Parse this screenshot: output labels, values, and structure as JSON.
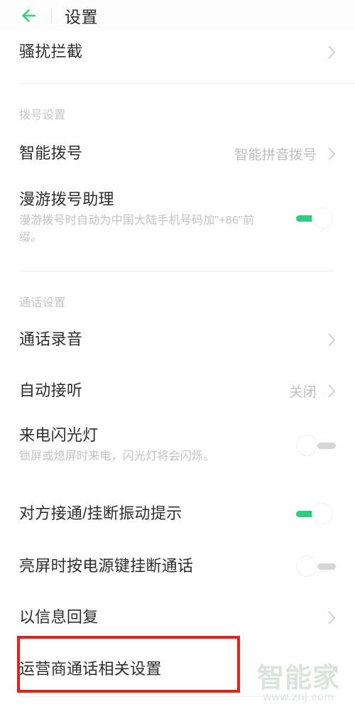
{
  "header": {
    "back_icon": "back-arrow-icon",
    "title": "设置",
    "accent_color": "#3ecf78"
  },
  "sections": [
    {
      "label": null,
      "rows": [
        {
          "name": "harassment-blocking",
          "title": "骚扰拦截",
          "desc": null,
          "value": null,
          "control": "chevron"
        }
      ]
    },
    {
      "label": "拨号设置",
      "rows": [
        {
          "name": "smart-dial",
          "title": "智能拨号",
          "desc": null,
          "value": "智能拼音拨号",
          "control": "chevron"
        },
        {
          "name": "roaming-dial-assistant",
          "title": "漫游拨号助理",
          "desc": "漫游拨号时自动为中国大陆手机号码加\"+86\"前缀。",
          "value": null,
          "control": "toggle",
          "toggle_state": "on"
        }
      ]
    },
    {
      "label": "通话设置",
      "rows": [
        {
          "name": "call-recording",
          "title": "通话录音",
          "desc": null,
          "value": null,
          "control": "chevron"
        },
        {
          "name": "auto-answer",
          "title": "自动接听",
          "desc": null,
          "value": "关闭",
          "control": "chevron"
        },
        {
          "name": "incoming-call-flash",
          "title": "来电闪光灯",
          "desc": "锁屏或熄屏时来电，闪光灯将会闪烁。",
          "value": null,
          "control": "toggle",
          "toggle_state": "off"
        },
        {
          "name": "connect-hangup-vibration",
          "title": "对方接通/挂断振动提示",
          "desc": null,
          "value": null,
          "control": "toggle",
          "toggle_state": "on"
        },
        {
          "name": "power-key-hangup",
          "title": "亮屏时按电源键挂断通话",
          "desc": null,
          "value": null,
          "control": "toggle",
          "toggle_state": "off"
        },
        {
          "name": "reply-with-message",
          "title": "以信息回复",
          "desc": null,
          "value": null,
          "control": "chevron"
        },
        {
          "name": "carrier-call-settings",
          "title": "运营商通话相关设置",
          "desc": null,
          "value": null,
          "control": "chevron",
          "highlighted": true
        }
      ]
    }
  ],
  "annotation": {
    "type": "red-rectangle",
    "color": "#f41c10",
    "target": "运营商通话相关设置"
  },
  "watermark": {
    "logo": "智能家",
    "url": "www.znj.com"
  },
  "toggle_colors": {
    "on": "#27d07e",
    "off": "#d6d6d6"
  }
}
